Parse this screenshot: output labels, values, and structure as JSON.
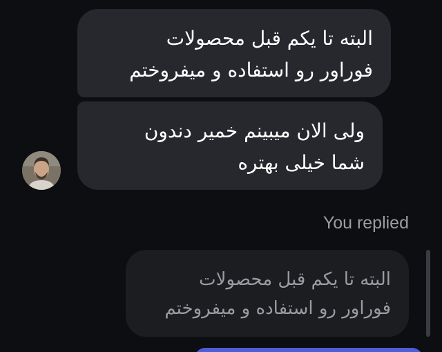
{
  "conversation": {
    "messages": [
      {
        "lines": [
          "البته تا یکم قبل محصولات",
          "فوراور رو استفاده و میفروختم"
        ]
      },
      {
        "lines": [
          "ولی الان میبینم خمیر دندون",
          "شما خیلی بهتره"
        ]
      }
    ],
    "reply_label": "You replied",
    "replied_message": {
      "lines": [
        "البته تا یکم قبل محصولات",
        "فوراور رو استفاده و میفروختم"
      ]
    }
  },
  "colors": {
    "background": "#0c0e12",
    "incoming_bubble": "#26282d",
    "quoted_bubble": "#1b1d21",
    "outgoing_bubble": "#4e5dd6"
  }
}
